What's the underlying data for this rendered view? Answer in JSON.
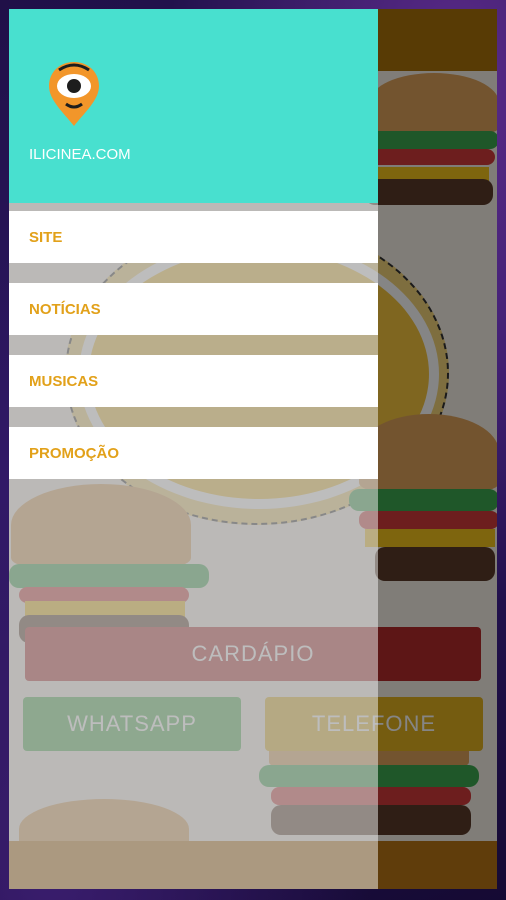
{
  "drawer": {
    "site_name": "ILICINEA.COM",
    "items": [
      {
        "label": "SITE"
      },
      {
        "label": "NOTÍCIAS"
      },
      {
        "label": "MUSICAS"
      },
      {
        "label": "PROMOÇÃO"
      }
    ],
    "accent_color": "#48e0cf",
    "menu_text_color": "#e2a11a"
  },
  "background": {
    "buttons": {
      "cardapio": "CARDÁPIO",
      "whatsapp": "WHATSAPP",
      "telefone": "TELEFONE"
    }
  },
  "icons": {
    "logo": "location-pin-eye-icon"
  }
}
